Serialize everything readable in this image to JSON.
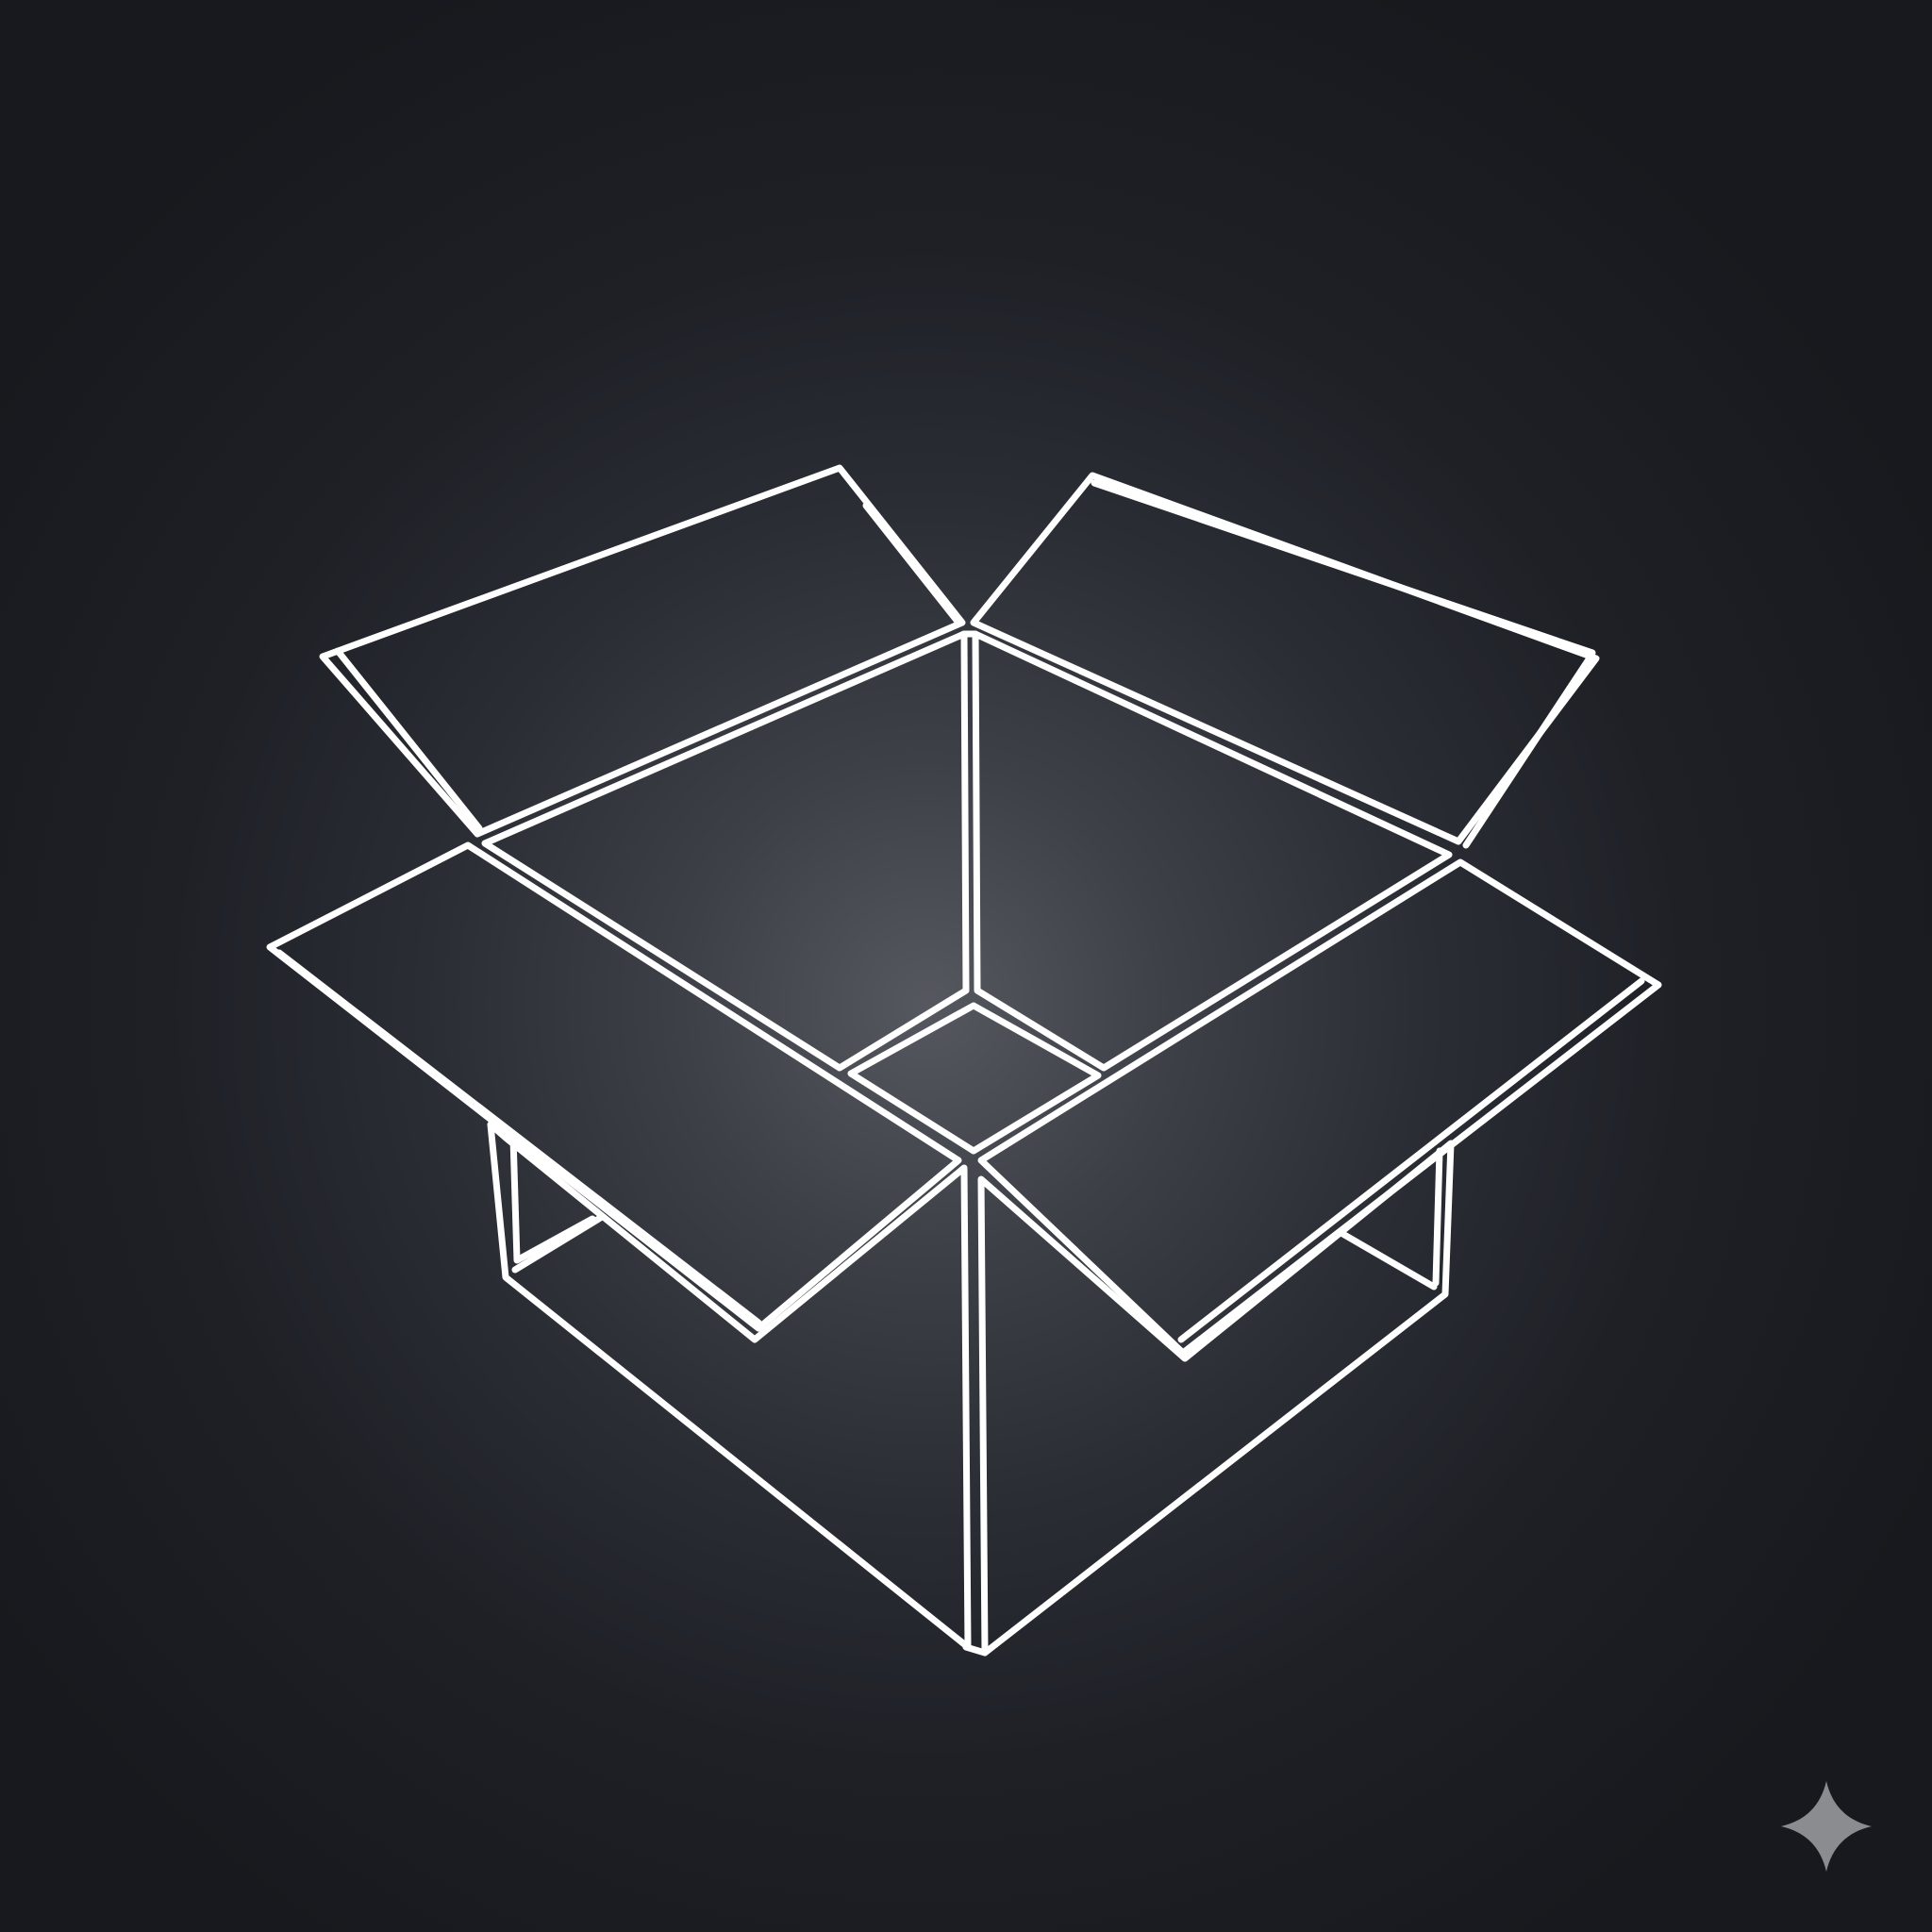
{
  "scene": {
    "subject": "open-cardboard-box-outline",
    "line_color": "#ffffff",
    "background_center": "#55585e",
    "background_edge": "#17191e"
  },
  "watermark": {
    "icon": "sparkle-icon",
    "color": "#8a8c90"
  }
}
